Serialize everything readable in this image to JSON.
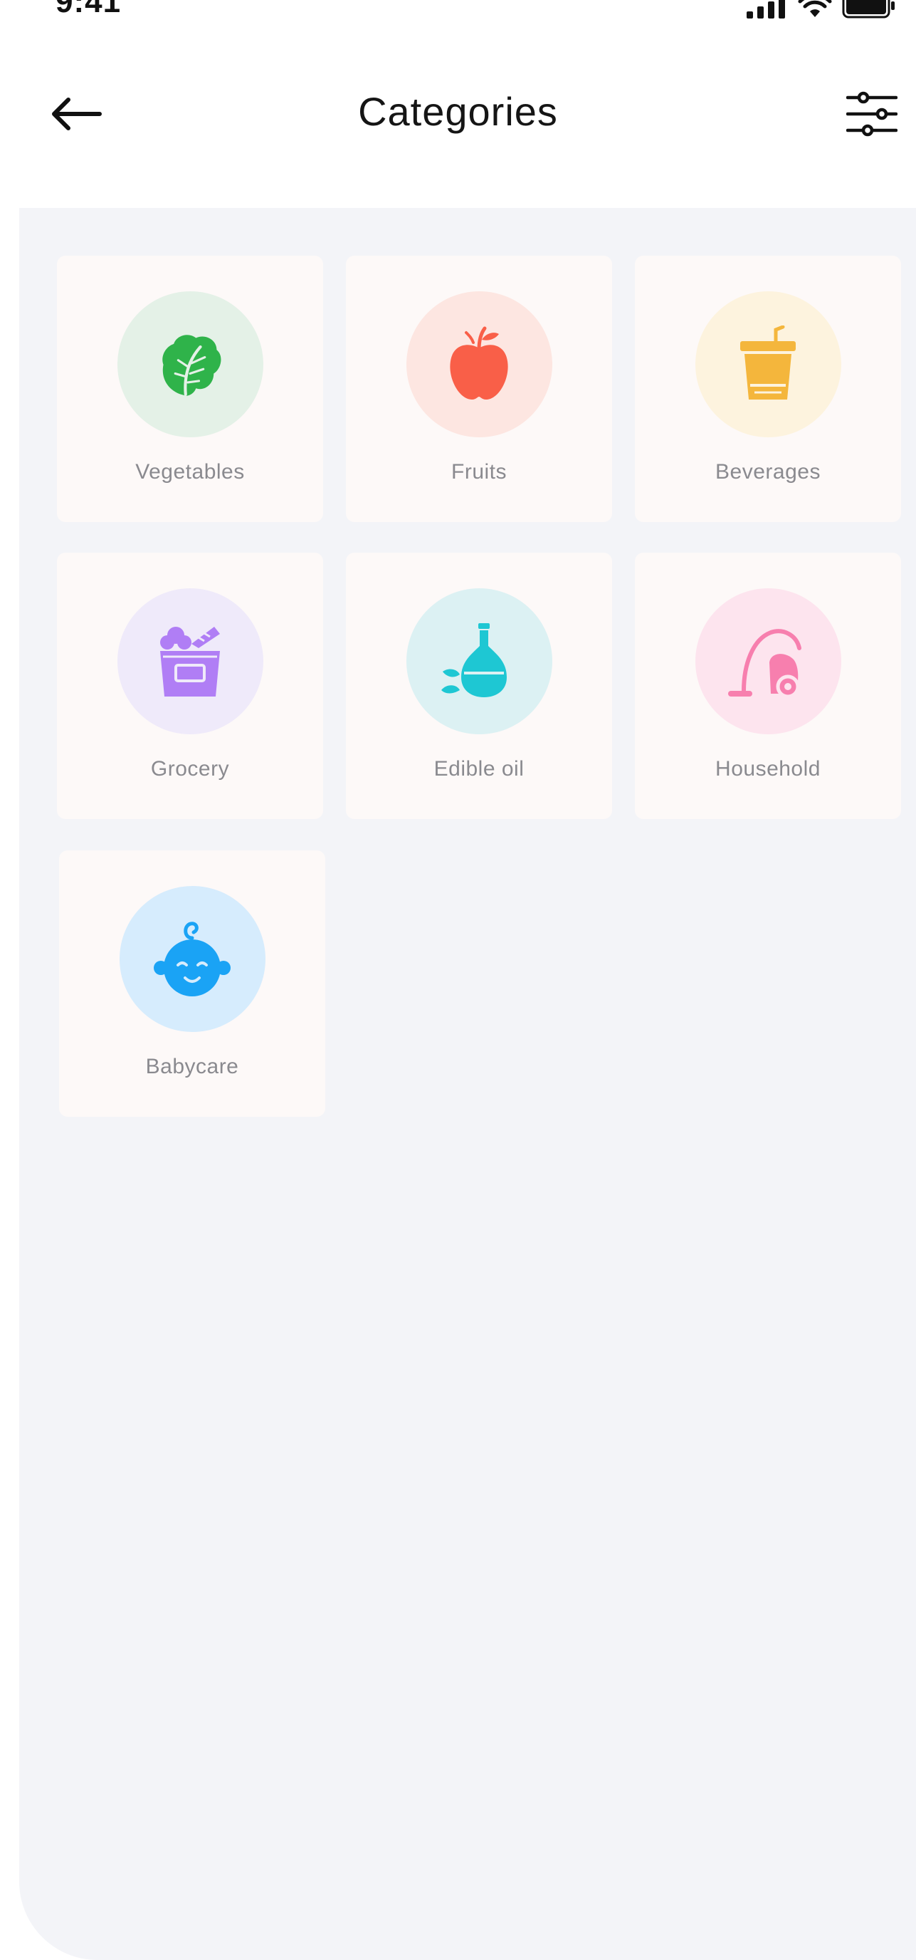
{
  "status_bar": {
    "time": "9:41"
  },
  "header": {
    "title": "Categories"
  },
  "categories": [
    {
      "label": "Vegetables",
      "icon": "lettuce-icon",
      "icon_color": "#2fb34a",
      "circle_color": "#e4f1e7"
    },
    {
      "label": "Fruits",
      "icon": "apple-icon",
      "icon_color": "#f95f48",
      "circle_color": "#fde6e1"
    },
    {
      "label": "Beverages",
      "icon": "drink-cup-icon",
      "icon_color": "#f4b63c",
      "circle_color": "#fdf3de"
    },
    {
      "label": "Grocery",
      "icon": "grocery-basket-icon",
      "icon_color": "#b07ef5",
      "circle_color": "#efeafa"
    },
    {
      "label": "Edible oil",
      "icon": "oil-bottle-icon",
      "icon_color": "#1ec7d3",
      "circle_color": "#dcf1f3"
    },
    {
      "label": "Household",
      "icon": "vacuum-cleaner-icon",
      "icon_color": "#f77fae",
      "circle_color": "#fde4ee"
    },
    {
      "label": "Babycare",
      "icon": "baby-face-icon",
      "icon_color": "#1aa3f5",
      "circle_color": "#d6ecfd"
    }
  ],
  "colors": {
    "content_bg": "#f3f4f8",
    "card_bg": "#fdf9f8",
    "title": "#151515",
    "label": "#8a8a8f"
  }
}
